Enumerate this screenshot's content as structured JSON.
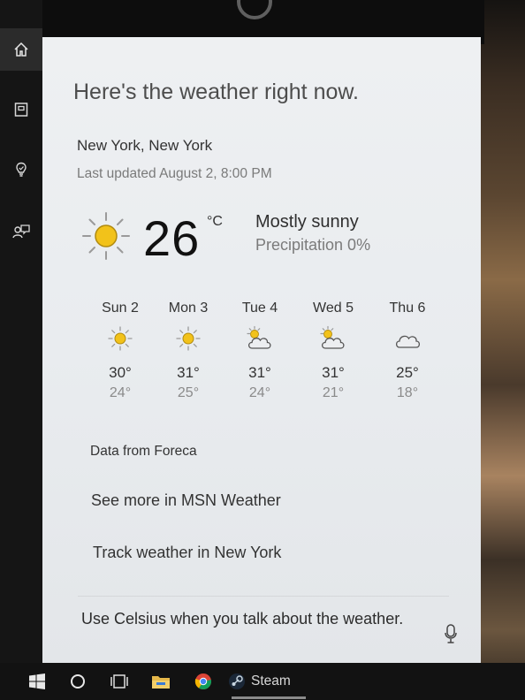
{
  "panel": {
    "greeting": "Here's the weather right now.",
    "location": "New York, New York",
    "last_updated": "Last updated August 2, 8:00 PM",
    "current": {
      "temperature": "26",
      "unit": "°C",
      "condition": "Mostly sunny",
      "precipitation": "Precipitation 0%",
      "icon": "sun-icon"
    },
    "forecast": [
      {
        "day": "Sun 2",
        "high": "30°",
        "low": "24°",
        "icon": "sun-icon"
      },
      {
        "day": "Mon 3",
        "high": "31°",
        "low": "25°",
        "icon": "sun-icon"
      },
      {
        "day": "Tue 4",
        "high": "31°",
        "low": "24°",
        "icon": "partly-cloudy-icon"
      },
      {
        "day": "Wed 5",
        "high": "31°",
        "low": "21°",
        "icon": "partly-cloudy-icon"
      },
      {
        "day": "Thu 6",
        "high": "25°",
        "low": "18°",
        "icon": "cloud-icon"
      }
    ],
    "source": "Data from Foreca",
    "links": {
      "msn": "See more in MSN Weather",
      "track": "Track weather in New York"
    },
    "tip": "Use Celsius when you talk about the weather."
  },
  "rail": {
    "items": [
      "home-icon",
      "notebook-icon",
      "reminders-icon",
      "feedback-icon"
    ]
  },
  "taskbar": {
    "steam_label": "Steam"
  },
  "colors": {
    "sun": "#f2c21a",
    "sun_rays": "#9a9a9a",
    "panel_bg": "#eceef0",
    "taskbar_bg": "#121212"
  }
}
